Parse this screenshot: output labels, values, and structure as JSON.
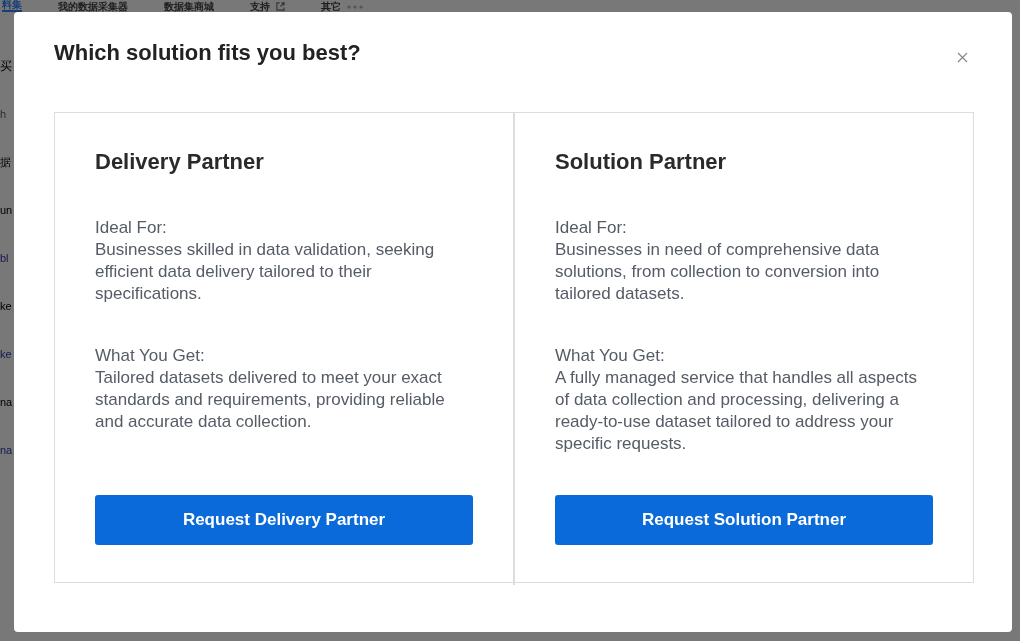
{
  "background_tabs": [
    {
      "label": "料集",
      "selected": true,
      "kind": "plain"
    },
    {
      "label": "我的数据采集器",
      "selected": false,
      "kind": "plain"
    },
    {
      "label": "数据集商城",
      "selected": false,
      "kind": "plain"
    },
    {
      "label": "支持",
      "selected": false,
      "kind": "external"
    },
    {
      "label": "其它",
      "selected": false,
      "kind": "more"
    }
  ],
  "background_fragments": [
    {
      "text": "买",
      "kind": "heading"
    },
    {
      "text": "h",
      "kind": "placeholder"
    },
    {
      "text": "据",
      "kind": "plain"
    },
    {
      "text": "un",
      "kind": "plain"
    },
    {
      "text": "bl",
      "kind": "link"
    },
    {
      "text": "ke",
      "kind": "plain"
    },
    {
      "text": "ke",
      "kind": "link"
    },
    {
      "text": "na",
      "kind": "plain"
    },
    {
      "text": "na",
      "kind": "link"
    }
  ],
  "dialog": {
    "title": "Which solution fits you best?",
    "options": [
      {
        "title": "Delivery Partner",
        "ideal_label": "Ideal For:",
        "ideal_text": "Businesses skilled in data validation, seeking efficient data delivery tailored to their specifications.",
        "get_label": "What You Get:",
        "get_text": "Tailored datasets delivered to meet your exact standards and requirements, providing reliable and accurate data collection.",
        "button": "Request Delivery Partner"
      },
      {
        "title": "Solution Partner",
        "ideal_label": "Ideal For:",
        "ideal_text": "Businesses in need of comprehensive data solutions, from collection to conversion into tailored datasets.",
        "get_label": "What You Get:",
        "get_text": "A fully managed service that handles all aspects of data collection and processing, delivering a ready-to-use dataset tailored to address your specific requests.",
        "button": "Request Solution Partner"
      }
    ]
  }
}
